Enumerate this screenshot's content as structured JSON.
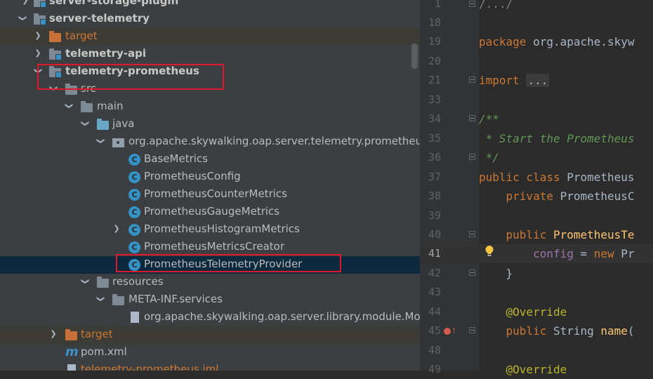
{
  "tree": {
    "rows": [
      {
        "label": "server-storage-plugin"
      },
      {
        "label": "server-telemetry"
      },
      {
        "label": "target"
      },
      {
        "label": "telemetry-api"
      },
      {
        "label": "telemetry-prometheus"
      },
      {
        "label": "src"
      },
      {
        "label": "main"
      },
      {
        "label": "java"
      },
      {
        "label": "org.apache.skywalking.oap.server.telemetry.prometheus"
      },
      {
        "label": "BaseMetrics"
      },
      {
        "label": "PrometheusConfig"
      },
      {
        "label": "PrometheusCounterMetrics"
      },
      {
        "label": "PrometheusGaugeMetrics"
      },
      {
        "label": "PrometheusHistogramMetrics"
      },
      {
        "label": "PrometheusMetricsCreator"
      },
      {
        "label": "PrometheusTelemetryProvider"
      },
      {
        "label": "resources"
      },
      {
        "label": "META-INF.services"
      },
      {
        "label": "org.apache.skywalking.oap.server.library.module.Mod"
      },
      {
        "label": "target"
      },
      {
        "label": "pom.xml"
      },
      {
        "label": "telemetry-prometheus.iml"
      }
    ],
    "icons": {
      "class_letter": "C",
      "maven_letter": "m"
    }
  },
  "editor": {
    "line_numbers": [
      "1",
      "18",
      "19",
      "20",
      "21",
      "33",
      "34",
      "35",
      "36",
      "37",
      "38",
      "39",
      "40",
      "41",
      "42",
      "43",
      "44",
      "45",
      "48",
      "49"
    ],
    "current_line": "41",
    "code": {
      "l1": "/.../",
      "l19_kw": "package",
      "l19_rest": " org.apache.skyw",
      "l21_kw": "import",
      "l21_fold": "...",
      "l34": "/**",
      "l35": " * Start the Prometheus",
      "l36": " */",
      "l37_kw": "public class",
      "l37_rest": " Prometheus",
      "l38_kw": "    private",
      "l38_rest": " PrometheusC",
      "l40_kw": "    public",
      "l40_fn": " PrometheusTe",
      "l41_fld": "        config",
      "l41_mid": " = ",
      "l41_kw": "new",
      "l41_rest": " Pr",
      "l42": "    }",
      "l44": "    @Override",
      "l45_kw": "    public",
      "l45_mid": " String ",
      "l45_fn": "name",
      "l45_rest": "(",
      "l49": "    @Override"
    }
  },
  "colors": {
    "accent": "#3592c4",
    "highlight_box": "#e0192a",
    "selection": "#0d293e"
  }
}
